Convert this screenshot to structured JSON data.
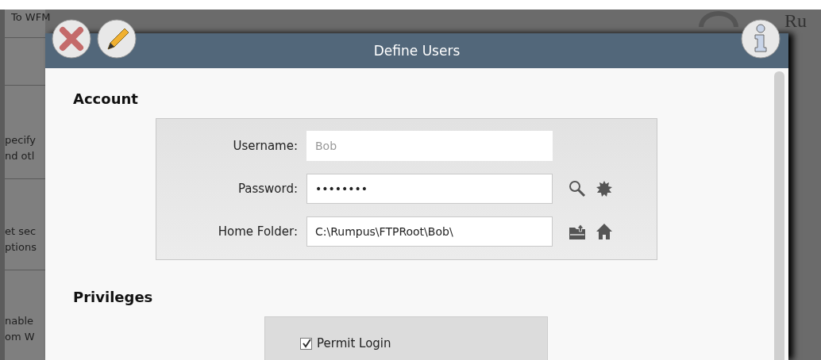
{
  "background": {
    "header_text": "To WFM",
    "logo_text": "Ru",
    "snippets": [
      [
        "pecify",
        "nd otl"
      ],
      [
        "et sec",
        "ptions"
      ],
      [
        "nable",
        "om W"
      ]
    ]
  },
  "window": {
    "title": "Define Users"
  },
  "account": {
    "heading": "Account",
    "fields": [
      {
        "label": "Username:",
        "value": "Bob",
        "disabled": true,
        "kind": "text"
      },
      {
        "label": "Password:",
        "value": "••••••••",
        "disabled": false,
        "kind": "password"
      },
      {
        "label": "Home Folder:",
        "value": "C:\\Rumpus\\FTPRoot\\Bob\\",
        "disabled": false,
        "kind": "folder"
      }
    ]
  },
  "privileges": {
    "heading": "Privileges",
    "options": [
      {
        "label": "Permit Login",
        "checked": true
      }
    ]
  }
}
